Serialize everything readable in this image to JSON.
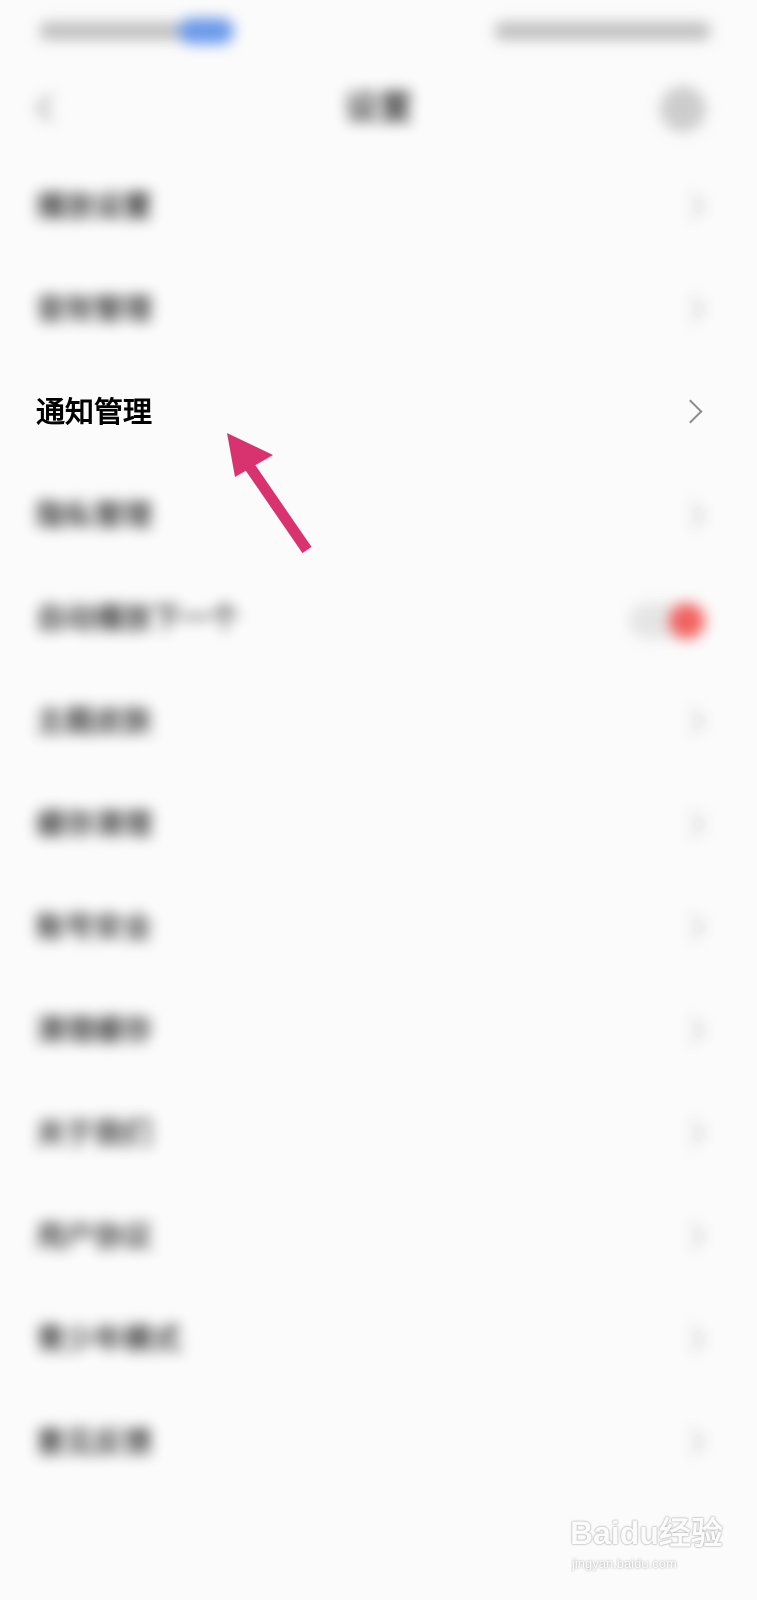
{
  "status_bar": {
    "colors": {
      "pill": "#5b8fe8"
    }
  },
  "header": {
    "title": "设置",
    "back_icon": "chevron-left-icon",
    "more_icon": "more-icon"
  },
  "rows": [
    {
      "label": "播放设置",
      "value": "",
      "control": "chevron"
    },
    {
      "label": "音效管理",
      "value": "",
      "control": "chevron"
    },
    {
      "label": "通知管理",
      "value": "",
      "control": "chevron",
      "highlighted": true
    },
    {
      "label": "隐私管理",
      "value": "",
      "control": "chevron"
    },
    {
      "label": "自动播放下一个",
      "value": "",
      "control": "toggle",
      "toggle_on": true
    },
    {
      "label": "主题皮肤",
      "value": "",
      "control": "chevron",
      "value_color": "pink"
    },
    {
      "label": "缓存清理",
      "value": "",
      "control": "chevron"
    },
    {
      "label": "账号安全",
      "value": "",
      "control": "chevron"
    },
    {
      "label": "清理缓存",
      "value": "",
      "control": "chevron"
    },
    {
      "label": "关于我们",
      "value": "",
      "control": "chevron"
    },
    {
      "label": "用户协议",
      "value": "",
      "control": "chevron"
    },
    {
      "label": "青少年模式",
      "value": "",
      "control": "chevron",
      "value_color": "pink"
    },
    {
      "label": "意见反馈",
      "value": "",
      "control": "chevron"
    }
  ],
  "annotation": {
    "color": "#d8336f",
    "icon": "arrow-icon"
  },
  "watermark": {
    "brand": "Baidu经验",
    "url": "jingyan.baidu.com"
  }
}
